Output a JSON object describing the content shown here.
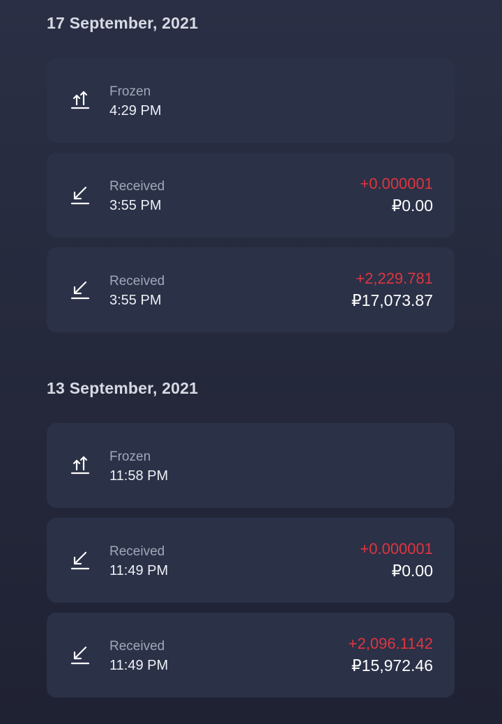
{
  "groups": [
    {
      "date": "17 September, 2021",
      "transactions": [
        {
          "type": "Frozen",
          "time": "4:29 PM",
          "icon": "frozen-icon",
          "crypto_amount": "",
          "fiat_amount": ""
        },
        {
          "type": "Received",
          "time": "3:55 PM",
          "icon": "received-icon",
          "crypto_amount": "+0.000001",
          "fiat_amount": "₽0.00"
        },
        {
          "type": "Received",
          "time": "3:55 PM",
          "icon": "received-icon",
          "crypto_amount": "+2,229.781",
          "fiat_amount": "₽17,073.87"
        }
      ]
    },
    {
      "date": "13 September, 2021",
      "transactions": [
        {
          "type": "Frozen",
          "time": "11:58 PM",
          "icon": "frozen-icon",
          "crypto_amount": "",
          "fiat_amount": ""
        },
        {
          "type": "Received",
          "time": "11:49 PM",
          "icon": "received-icon",
          "crypto_amount": "+0.000001",
          "fiat_amount": "₽0.00"
        },
        {
          "type": "Received",
          "time": "11:49 PM",
          "icon": "received-icon",
          "crypto_amount": "+2,096.1142",
          "fiat_amount": "₽15,972.46"
        }
      ]
    }
  ],
  "colors": {
    "background": "#262a3d",
    "card": "#2b3147",
    "positive_amount": "#e0353f",
    "secondary_text": "#a2a7b8"
  }
}
